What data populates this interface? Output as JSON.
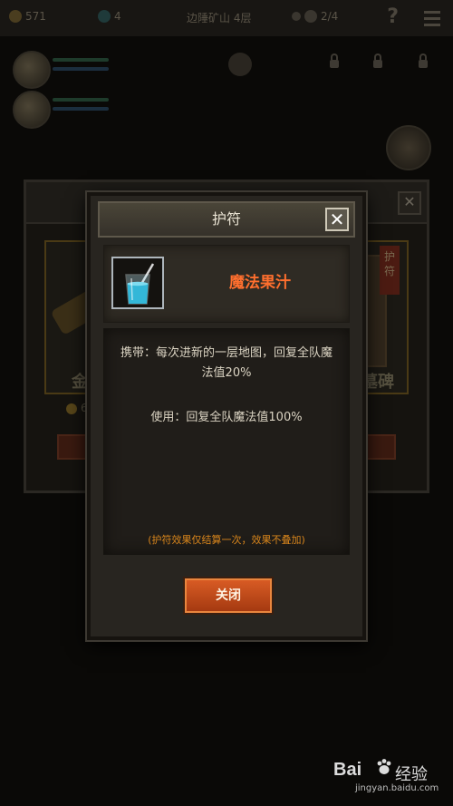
{
  "background": {
    "topbar": {
      "stat1": "571",
      "stat2": "4",
      "location": "边陲矿山 4层",
      "stat3": "2/4"
    },
    "card_left_label": "金",
    "card_left_price": "6",
    "card_right_label": "墓碑",
    "card_right_tag": "护符"
  },
  "modal": {
    "title": "护符",
    "close_icon": "close-x-icon",
    "item": {
      "icon": "juice-glass-icon",
      "name": "魔法果汁"
    },
    "description": {
      "carry": "携带：每次进新的一层地图，回复全队魔法值20%",
      "use": "使用：回复全队魔法值100%",
      "note": "(护符效果仅结算一次，效果不叠加)"
    },
    "close_button_label": "关闭"
  },
  "watermark": {
    "brand_left": "Bai",
    "brand_right": "经验",
    "url": "jingyan.baidu.com"
  },
  "colors": {
    "accent_orange": "#ff6f2e",
    "note_orange": "#d9861c",
    "button_orange": "#c8501c"
  }
}
